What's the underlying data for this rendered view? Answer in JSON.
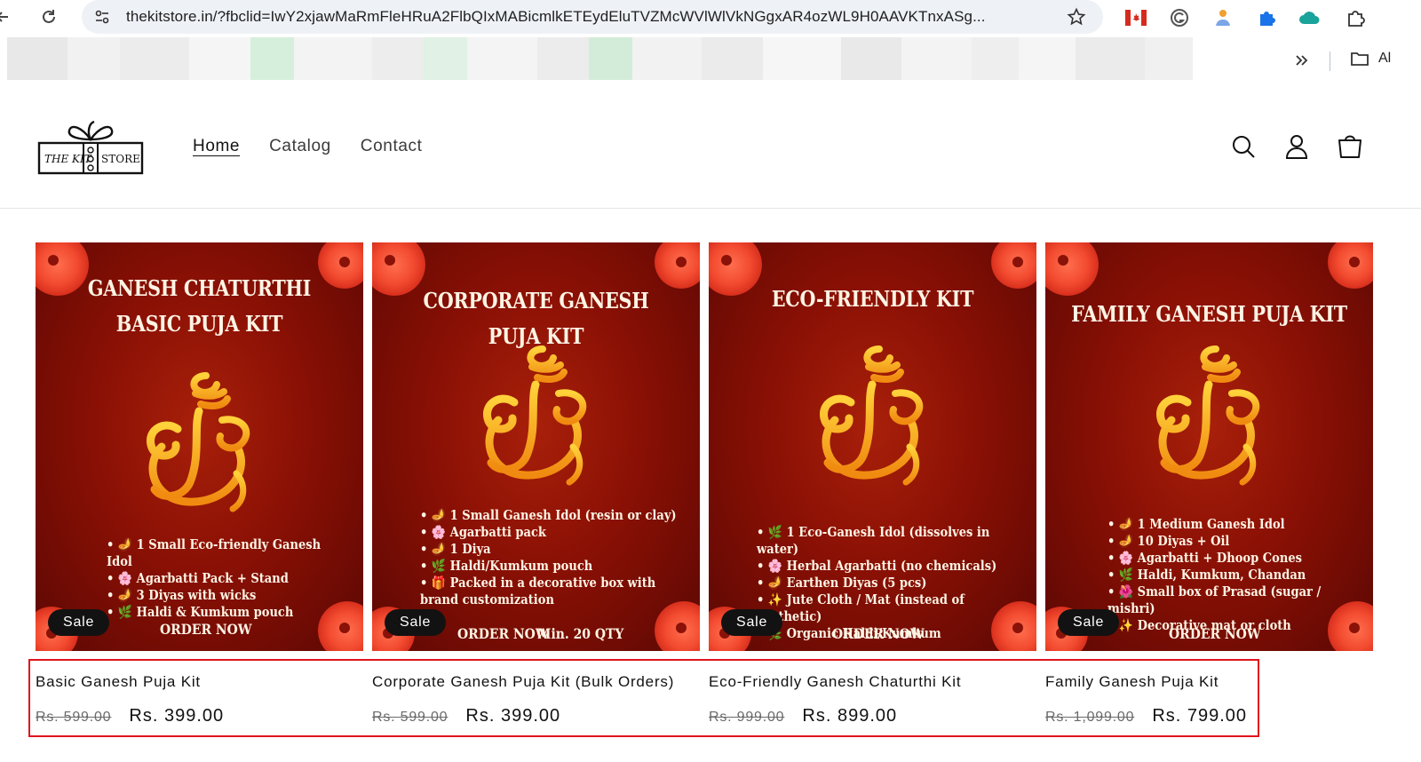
{
  "browser": {
    "url": "thekitstore.in/?fbclid=IwY2xjawMaRmFleHRuA2FlbQIxMABicmlkETEydEluTVZMcWVlWlVkNGgxAR4ozWL9H0AAVKTnxASg...",
    "icons": [
      "back-arrow-icon",
      "reload-icon",
      "site-info-icon",
      "bookmark-star-icon",
      "canada-flag-icon",
      "grammarly-icon",
      "extension-puzzle-icon",
      "extensions-icon"
    ],
    "bookmarks_folder_label": "Al"
  },
  "store": {
    "logo_text_left": "THE KIT",
    "logo_text_right": "STORE",
    "nav": [
      {
        "label": "Home",
        "active": true
      },
      {
        "label": "Catalog",
        "active": false
      },
      {
        "label": "Contact",
        "active": false
      }
    ],
    "header_icons": [
      "search-icon",
      "account-icon",
      "cart-icon"
    ]
  },
  "products": [
    {
      "image_title_lines": [
        "GANESH CHATURTHI",
        "BASIC PUJA KIT"
      ],
      "image_bullets": [
        "🪔 1 Small Eco-friendly Ganesh Idol",
        "🌸 Agarbatti Pack + Stand",
        "🪔 3 Diyas with wicks",
        "🌿 Haldi & Kumkum pouch"
      ],
      "image_cta": "ORDER NOW",
      "image_cta_extra": "",
      "badge": "Sale",
      "name": "Basic Ganesh Puja Kit",
      "compare_price": "Rs. 599.00",
      "price": "Rs. 399.00"
    },
    {
      "image_title_lines": [
        "CORPORATE GANESH PUJA KIT"
      ],
      "image_bullets": [
        "🪔 1 Small Ganesh Idol (resin or clay)",
        "🌸 Agarbatti pack",
        "🪔 1 Diya",
        "🌿 Haldi/Kumkum pouch",
        "🎁 Packed in a decorative box with brand customization"
      ],
      "image_cta": "ORDER NOW",
      "image_cta_extra": "Min. 20 QTY",
      "badge": "Sale",
      "name": "Corporate Ganesh Puja Kit (Bulk Orders)",
      "compare_price": "Rs. 599.00",
      "price": "Rs. 399.00"
    },
    {
      "image_title_lines": [
        "ECO-FRIENDLY KIT"
      ],
      "image_bullets": [
        "🌿 1 Eco-Ganesh Idol (dissolves in water)",
        "🌸 Herbal Agarbatti (no chemicals)",
        "🪔 Earthen Diyas (5 pcs)",
        "✨ Jute Cloth / Mat (instead of synthetic)",
        "🌿 Organic Haldi/Kumkum"
      ],
      "image_cta": "ORDER NOW",
      "image_cta_extra": "",
      "badge": "Sale",
      "name": "Eco-Friendly Ganesh Chaturthi Kit",
      "compare_price": "Rs. 999.00",
      "price": "Rs. 899.00"
    },
    {
      "image_title_lines": [
        "FAMILY GANESH PUJA  KIT"
      ],
      "image_bullets": [
        "🪔 1 Medium Ganesh Idol",
        "🪔 10 Diyas + Oil",
        "🌸 Agarbatti + Dhoop Cones",
        "🌿 Haldi, Kumkum, Chandan",
        "🌺 Small box of Prasad (sugar / mishri)",
        "✨ Decorative mat or cloth"
      ],
      "image_cta": "ORDER NOW",
      "image_cta_extra": "",
      "badge": "Sale",
      "name": "Family Ganesh Puja Kit",
      "compare_price": "Rs. 1,099.00",
      "price": "Rs. 799.00"
    }
  ],
  "colors": {
    "highlight_box": "#e0141e",
    "card_background": "#8a1005",
    "sale_badge": "#121212"
  }
}
